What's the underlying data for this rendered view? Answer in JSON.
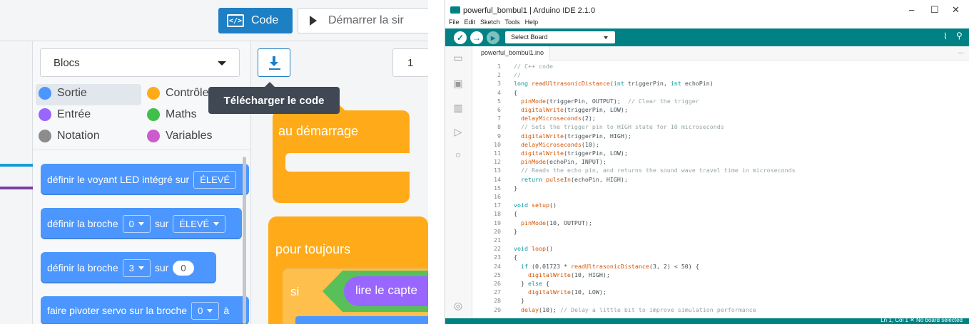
{
  "tinkercad": {
    "code_button": "Code",
    "code_icon": "</>",
    "start_sim_button": "Démarrer la sir",
    "blocks_select": "Blocs",
    "page_selector": "1",
    "tooltip": "Télécharger le code",
    "categories": [
      {
        "label": "Sortie",
        "color": "#4c97ff"
      },
      {
        "label": "Contrôle",
        "color": "#ffab19"
      },
      {
        "label": "Entrée",
        "color": "#9966ff"
      },
      {
        "label": "Maths",
        "color": "#40bf4a"
      },
      {
        "label": "Notation",
        "color": "#8c8c8c"
      },
      {
        "label": "Variables",
        "color": "#cc5ccc"
      }
    ],
    "palette": {
      "b1_text": "définir le voyant LED intégré sur",
      "b1_value": "ÉLEVÉ",
      "b2_text": "définir la broche",
      "b2_pin": "0",
      "b2_sur": "sur",
      "b2_value": "ÉLEVÉ",
      "b3_text": "définir la broche",
      "b3_pin": "3",
      "b3_sur": "sur",
      "b3_value": "0",
      "b4_text": "faire pivoter servo sur la broche",
      "b4_pin": "0",
      "b4_suffix": "à"
    },
    "workspace": {
      "start_hat": "au démarrage",
      "forever": "pour toujours",
      "if": "si",
      "sensor": "lire le capte"
    }
  },
  "arduino": {
    "window_title": "powerful_bombul1 | Arduino IDE 2.1.0",
    "menu": [
      "File",
      "Edit",
      "Sketch",
      "Tools",
      "Help"
    ],
    "board_select": "Select Board",
    "file_tab": "powerful_bombul1.ino",
    "tab_more": "...",
    "status": "Ln 1, Col 1   ✕ No board selected",
    "code_lines": [
      {
        "n": "1",
        "t": "// C++ code"
      },
      {
        "n": "2",
        "t": "//"
      },
      {
        "n": "3",
        "t": "long readUltrasonicDistance(int triggerPin, int echoPin)"
      },
      {
        "n": "4",
        "t": "{"
      },
      {
        "n": "5",
        "t": "  pinMode(triggerPin, OUTPUT);  // Clear the trigger"
      },
      {
        "n": "6",
        "t": "  digitalWrite(triggerPin, LOW);"
      },
      {
        "n": "7",
        "t": "  delayMicroseconds(2);"
      },
      {
        "n": "8",
        "t": "  // Sets the trigger pin to HIGH state for 10 microseconds"
      },
      {
        "n": "9",
        "t": "  digitalWrite(triggerPin, HIGH);"
      },
      {
        "n": "10",
        "t": "  delayMicroseconds(10);"
      },
      {
        "n": "11",
        "t": "  digitalWrite(triggerPin, LOW);"
      },
      {
        "n": "12",
        "t": "  pinMode(echoPin, INPUT);"
      },
      {
        "n": "13",
        "t": "  // Reads the echo pin, and returns the sound wave travel time in microseconds"
      },
      {
        "n": "14",
        "t": "  return pulseIn(echoPin, HIGH);"
      },
      {
        "n": "15",
        "t": "}"
      },
      {
        "n": "16",
        "t": ""
      },
      {
        "n": "17",
        "t": "void setup()"
      },
      {
        "n": "18",
        "t": "{"
      },
      {
        "n": "19",
        "t": "  pinMode(10, OUTPUT);"
      },
      {
        "n": "20",
        "t": "}"
      },
      {
        "n": "21",
        "t": ""
      },
      {
        "n": "22",
        "t": "void loop()"
      },
      {
        "n": "23",
        "t": "{"
      },
      {
        "n": "24",
        "t": "  if (0.01723 * readUltrasonicDistance(3, 2) < 50) {"
      },
      {
        "n": "25",
        "t": "    digitalWrite(10, HIGH);"
      },
      {
        "n": "26",
        "t": "  } else {"
      },
      {
        "n": "27",
        "t": "    digitalWrite(10, LOW);"
      },
      {
        "n": "28",
        "t": "  }"
      },
      {
        "n": "29",
        "t": "  delay(10); // Delay a little bit to improve simulation performance"
      }
    ]
  }
}
